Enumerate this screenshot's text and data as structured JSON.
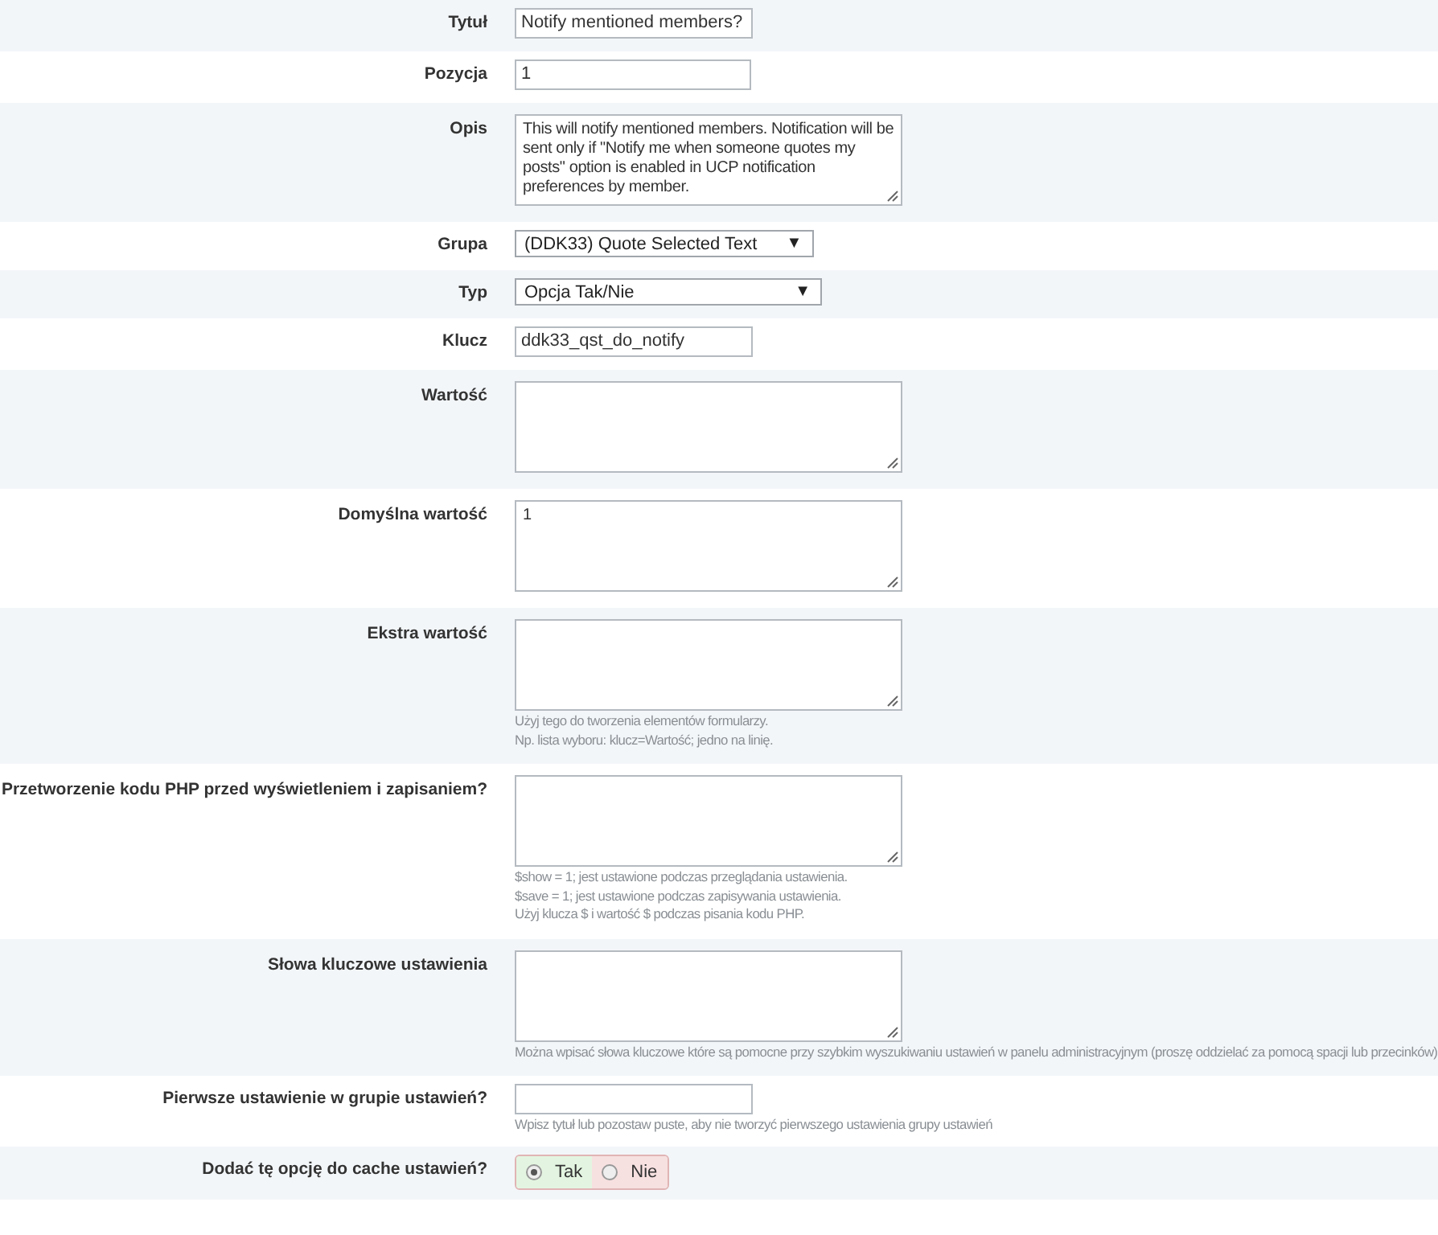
{
  "rows": [
    {
      "label": "Tytuł",
      "kind": "input",
      "value": "Notify mentioned members?"
    },
    {
      "label": "Pozycja",
      "kind": "input",
      "value": "1",
      "wide": true
    },
    {
      "label": "Opis",
      "kind": "textarea",
      "value": "This will notify mentioned members. Notification will be sent only if \"Notify me when someone quotes my posts\" option is enabled in UCP notification preferences by member."
    },
    {
      "label": "Grupa",
      "kind": "select",
      "value": "(DDK33) Quote Selected Text",
      "arrow": "▼"
    },
    {
      "label": "Typ",
      "kind": "select",
      "value": "Opcja Tak/Nie",
      "wide": true,
      "arrow": "▼"
    },
    {
      "label": "Klucz",
      "kind": "input",
      "value": "ddk33_qst_do_notify"
    },
    {
      "label": "Wartość",
      "kind": "textarea"
    },
    {
      "label": "Domyślna wartość",
      "kind": "textarea",
      "value": "1"
    },
    {
      "label": "Ekstra wartość",
      "kind": "textarea",
      "hints": [
        "Użyj tego do tworzenia elementów formularzy.",
        "Np. lista wyboru: klucz=Wartość; jedno na linię."
      ]
    },
    {
      "label": "Przetworzenie kodu PHP przed wyświetleniem i zapisaniem?",
      "kind": "textarea",
      "hints": [
        "$show = 1; jest ustawione podczas przeglądania ustawienia.",
        "$save = 1; jest ustawione podczas zapisywania ustawienia.",
        "Użyj klucza $ i wartość $ podczas pisania kodu PHP."
      ]
    },
    {
      "label": "Słowa kluczowe ustawienia",
      "kind": "textarea",
      "hints": [
        "Można wpisać słowa kluczowe które są pomocne przy szybkim wyszukiwaniu ustawień w panelu administracyjnym (proszę oddzielać za pomocą spacji lub przecinków)"
      ]
    },
    {
      "label": "Pierwsze ustawienie w grupie ustawień?",
      "kind": "input",
      "hints": [
        "Wpisz tytuł lub pozostaw puste, aby nie tworzyć pierwszego ustawienia grupy ustawień"
      ]
    },
    {
      "label": "Dodać tę opcję do cache ustawień?",
      "kind": "radio",
      "options": [
        {
          "label": "Tak",
          "selected": true,
          "color": "#e3f5e0"
        },
        {
          "label": "Nie",
          "selected": false,
          "color": "#f7e0e0"
        }
      ]
    }
  ]
}
